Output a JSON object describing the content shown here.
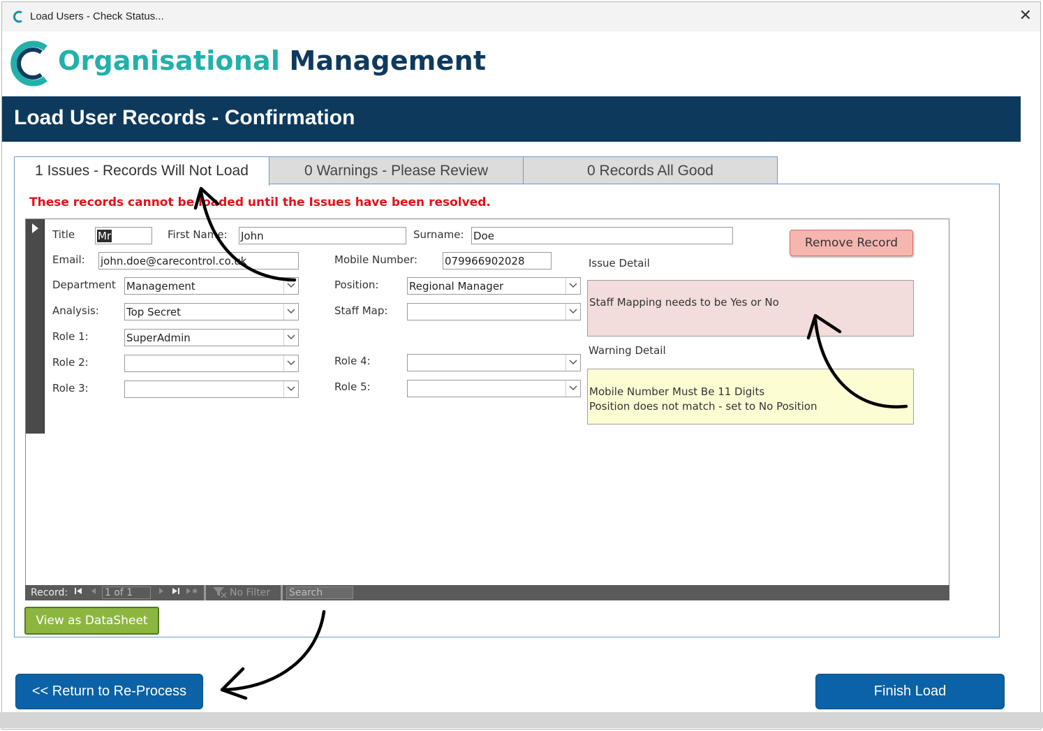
{
  "window": {
    "title": "Load Users - Check Status...",
    "close_glyph": "✕"
  },
  "brand": {
    "word1": "Organisational",
    "word2": "Management",
    "teal": "#21b1aa",
    "navy": "#0e3a5e"
  },
  "banner": {
    "title": "Load User Records - Confirmation",
    "color": "#0d3a5c"
  },
  "tabs": [
    {
      "label": "1 Issues - Records Will Not Load",
      "active": true
    },
    {
      "label": "0 Warnings - Please Review",
      "active": false
    },
    {
      "label": "0 Records All Good",
      "active": false
    }
  ],
  "issues_message": "These records cannot be loaded until the Issues have been resolved.",
  "form": {
    "title_label": "Title",
    "title_value": "Mr",
    "first_name_label": "First Name:",
    "first_name_value": "John",
    "surname_label": "Surname:",
    "surname_value": "Doe",
    "email_label": "Email:",
    "email_value": "john.doe@carecontrol.co.uk",
    "mobile_label": "Mobile Number:",
    "mobile_value": "079966902028",
    "department_label": "Department",
    "department_value": "Management",
    "position_label": "Position:",
    "position_value": "Regional Manager",
    "analysis_label": "Analysis:",
    "analysis_value": "Top Secret",
    "staff_map_label": "Staff Map:",
    "staff_map_value": "",
    "role1_label": "Role 1:",
    "role1_value": "SuperAdmin",
    "role2_label": "Role 2:",
    "role2_value": "",
    "role3_label": "Role 3:",
    "role3_value": "",
    "role4_label": "Role 4:",
    "role4_value": "",
    "role5_label": "Role 5:",
    "role5_value": "",
    "remove_button": "Remove Record",
    "issue_detail_label": "Issue Detail",
    "issue_detail_text": "Staff Mapping needs to be Yes or No",
    "warning_detail_label": "Warning Detail",
    "warning_detail_lines": [
      "Mobile Number Must Be 11 Digits",
      "Position does not match - set to No Position"
    ]
  },
  "navigation": {
    "record_label": "Record:",
    "position_text": "1 of 1",
    "filter_label": "No Filter",
    "search_label": "Search"
  },
  "buttons": {
    "datasheet": "View as DataSheet",
    "return": "<< Return to Re-Process",
    "finish": "Finish Load"
  },
  "colors": {
    "error_red": "#e0131a",
    "button_blue": "#0b62a6",
    "datasheet_green": "#8db640",
    "remove_red": "#f6b6b0",
    "issue_bg": "#f2dcdc",
    "warning_bg": "#fdfdd4"
  }
}
